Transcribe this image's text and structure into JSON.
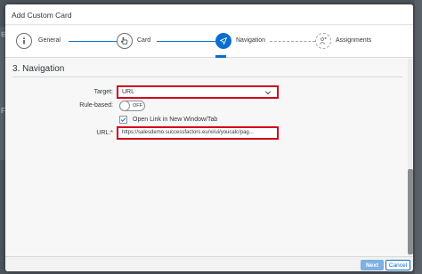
{
  "dialog": {
    "title": "Add Custom Card"
  },
  "wizard": {
    "steps": [
      {
        "label": "General",
        "icon": "info-icon",
        "state": "complete"
      },
      {
        "label": "Card",
        "icon": "card-icon",
        "state": "complete"
      },
      {
        "label": "Navigation",
        "icon": "navigation-arrow-icon",
        "state": "active"
      },
      {
        "label": "Assignments",
        "icon": "assignment-icon",
        "state": "pending"
      }
    ]
  },
  "section": {
    "title": "3. Navigation"
  },
  "form": {
    "target": {
      "label": "Target:",
      "value": "URL"
    },
    "rule_based": {
      "label": "Rule-based:",
      "state": "OFF"
    },
    "open_new_window": {
      "label": "Open Link in New Window/Tab",
      "checked": true
    },
    "url": {
      "label": "URL:",
      "required_marker": "*",
      "value": "https://salesdemo.successfactors.eu/xi/ui/youcalc/pag..."
    }
  },
  "footer": {
    "next_label": "Next",
    "cancel_label": "Cancel"
  },
  "colors": {
    "accent": "#0a6ed1",
    "highlight_border": "#d0021b",
    "next_disabled": "#7fb1e3"
  }
}
